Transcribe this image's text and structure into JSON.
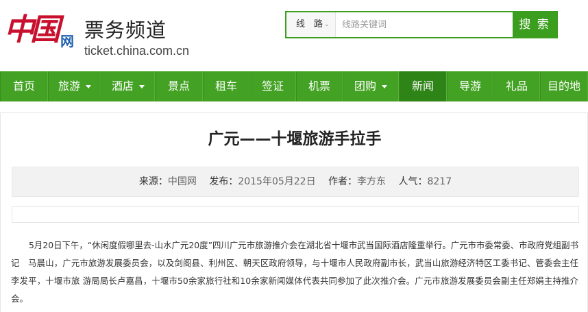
{
  "header": {
    "logo_han": "中国",
    "logo_wang": "网",
    "channel_title": "票务频道",
    "channel_domain": "ticket.china.com.cn"
  },
  "search": {
    "type_label": "线　路",
    "placeholder": "线路关键词",
    "value": "",
    "button_label": "搜 索"
  },
  "nav": {
    "items": [
      {
        "label": "首页",
        "dropdown": false,
        "active": false
      },
      {
        "label": "旅游",
        "dropdown": true,
        "active": false
      },
      {
        "label": "酒店",
        "dropdown": true,
        "active": false
      },
      {
        "label": "景点",
        "dropdown": false,
        "active": false
      },
      {
        "label": "租车",
        "dropdown": false,
        "active": false
      },
      {
        "label": "签证",
        "dropdown": false,
        "active": false
      },
      {
        "label": "机票",
        "dropdown": false,
        "active": false
      },
      {
        "label": "团购",
        "dropdown": true,
        "active": false
      },
      {
        "label": "新闻",
        "dropdown": false,
        "active": true
      },
      {
        "label": "导游",
        "dropdown": false,
        "active": false
      },
      {
        "label": "礼品",
        "dropdown": false,
        "active": false
      },
      {
        "label": "目的地",
        "dropdown": false,
        "active": false
      }
    ]
  },
  "article": {
    "title": "广元——十堰旅游手拉手",
    "meta": {
      "source_label": "来源：",
      "source": "中国网",
      "date_label": "发布：",
      "date": "2015年05月22日",
      "author_label": "作者：",
      "author": "李方东",
      "views_label": "人气：",
      "views": "8217"
    },
    "body": "5月20日下午，“休闲度假哪里去-山水广元20度”四川广元市旅游推介会在湖北省十堰市武当国际酒店隆重举行。广元市市委常委、市政府党组副书记　马晨山，广元市旅游发展委员会，以及剑阁县、利州区、朝天区政府领导，与十堰市人民政府副市长，武当山旅游经济特区工委书记、管委会主任李发平，十堰市旅 游局局长卢嘉昌，十堰市50余家旅行社和10余家新闻媒体代表共同参加了此次推介会。广元市旅游发展委员会副主任郑娟主持推介会。"
  },
  "colors": {
    "brand_green": "#43a223",
    "active_green": "#2f8417",
    "logo_red": "#c8102e",
    "logo_blue": "#1f5fae"
  }
}
